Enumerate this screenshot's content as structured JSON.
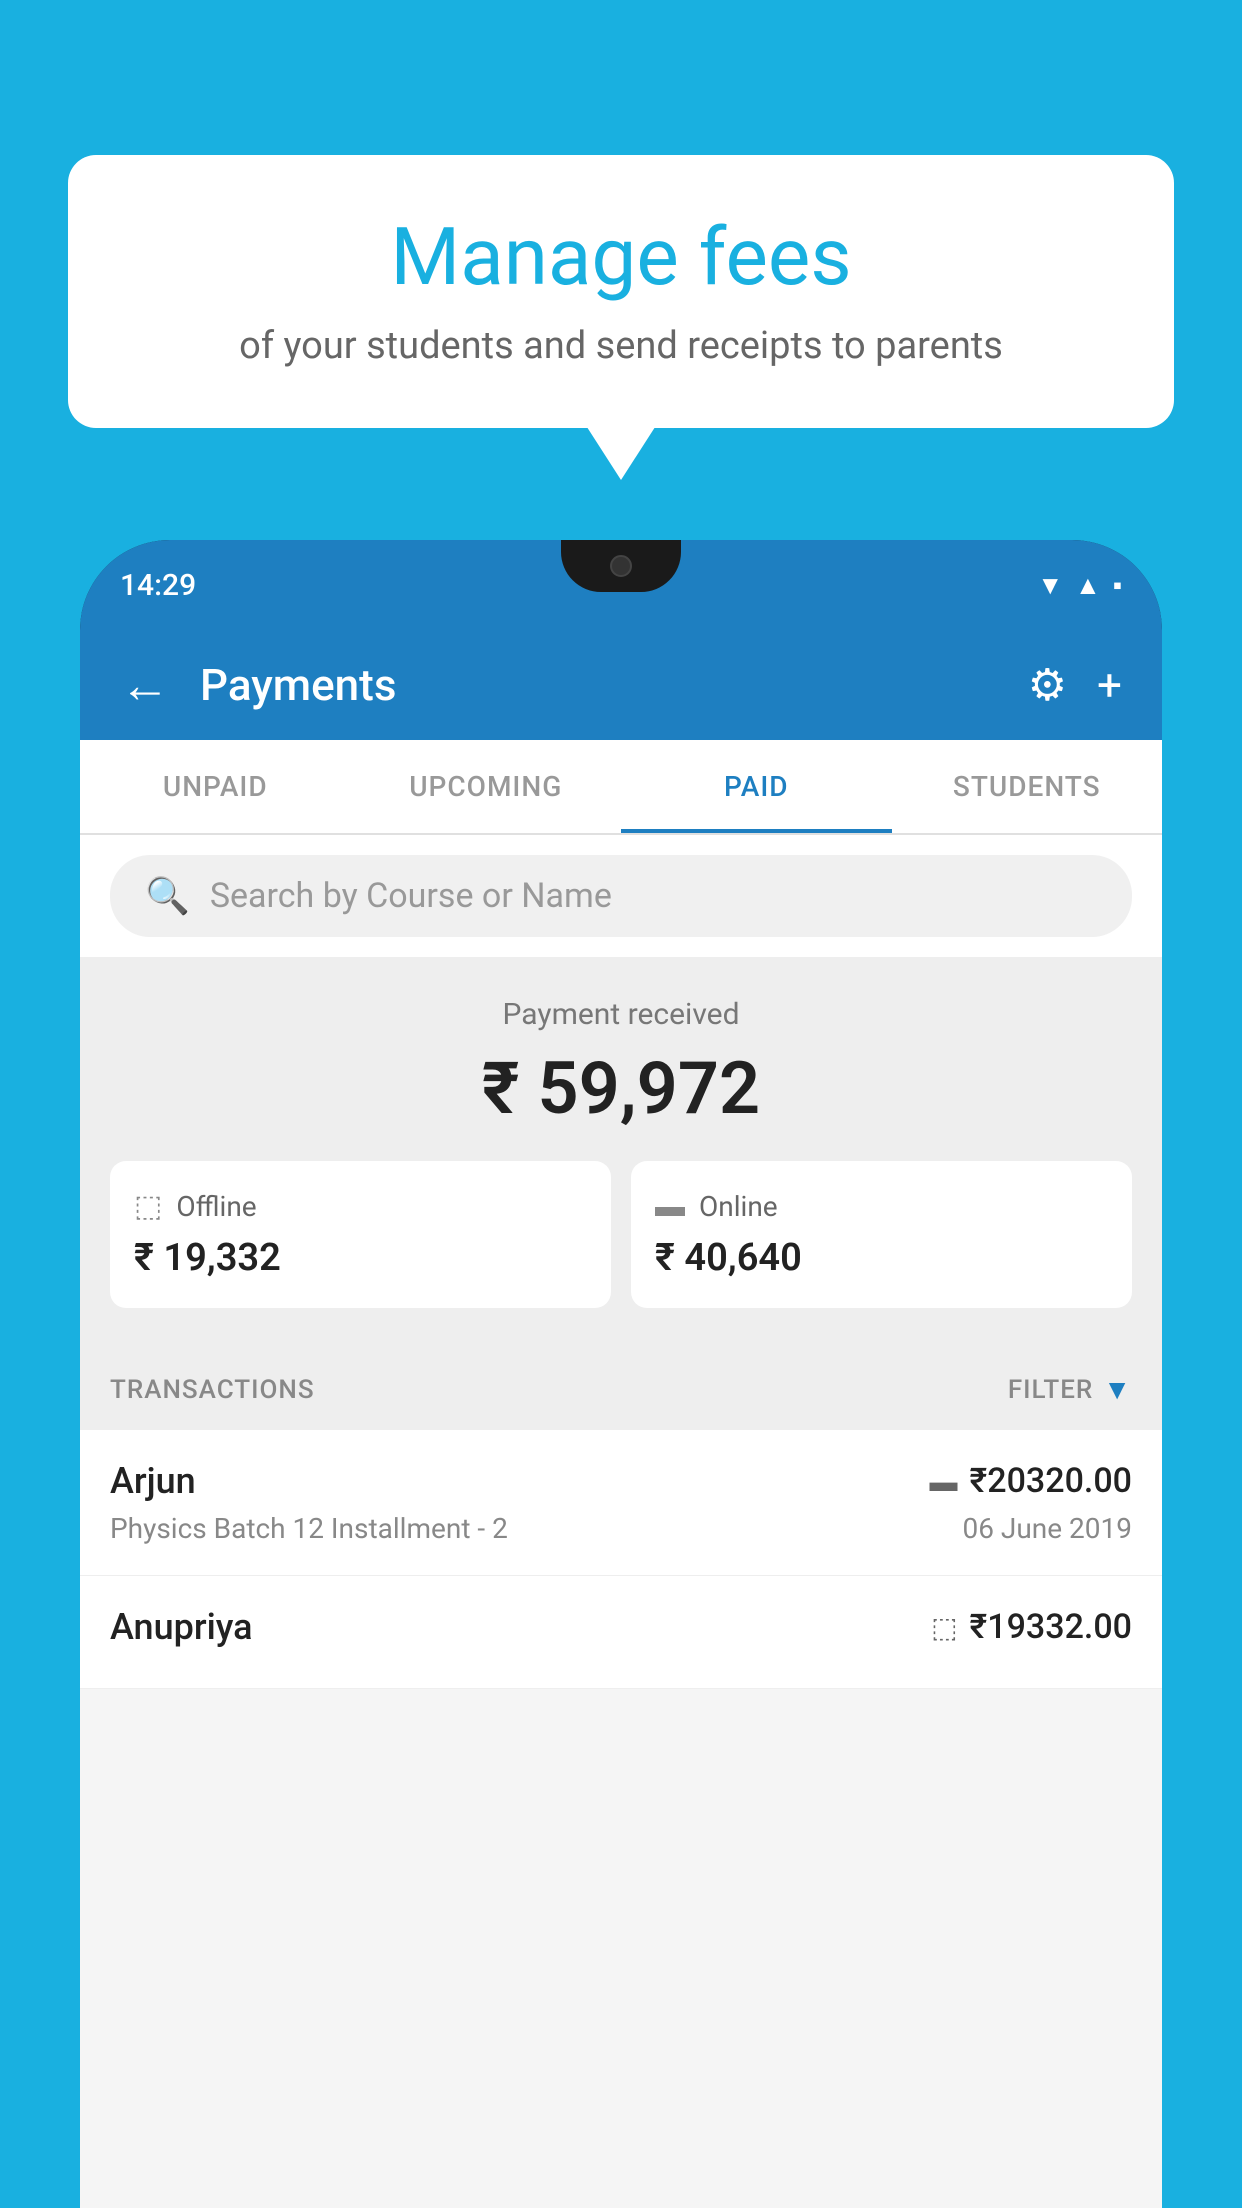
{
  "background": {
    "color": "#19b0e0"
  },
  "bubble": {
    "title": "Manage fees",
    "subtitle": "of your students and send receipts to parents"
  },
  "phone": {
    "status_bar": {
      "time": "14:29"
    },
    "app_bar": {
      "title": "Payments",
      "back_label": "←",
      "settings_label": "⚙",
      "add_label": "+"
    },
    "tabs": [
      {
        "label": "UNPAID",
        "active": false
      },
      {
        "label": "UPCOMING",
        "active": false
      },
      {
        "label": "PAID",
        "active": true
      },
      {
        "label": "STUDENTS",
        "active": false
      }
    ],
    "search": {
      "placeholder": "Search by Course or Name"
    },
    "payment_summary": {
      "label": "Payment received",
      "amount": "₹ 59,972",
      "offline": {
        "type": "Offline",
        "amount": "₹ 19,332"
      },
      "online": {
        "type": "Online",
        "amount": "₹ 40,640"
      }
    },
    "transactions": {
      "header_label": "TRANSACTIONS",
      "filter_label": "FILTER",
      "rows": [
        {
          "name": "Arjun",
          "course": "Physics Batch 12 Installment - 2",
          "amount": "₹20320.00",
          "date": "06 June 2019",
          "mode_icon": "card"
        },
        {
          "name": "Anupriya",
          "amount": "₹19332.00",
          "mode_icon": "cash"
        }
      ]
    }
  }
}
